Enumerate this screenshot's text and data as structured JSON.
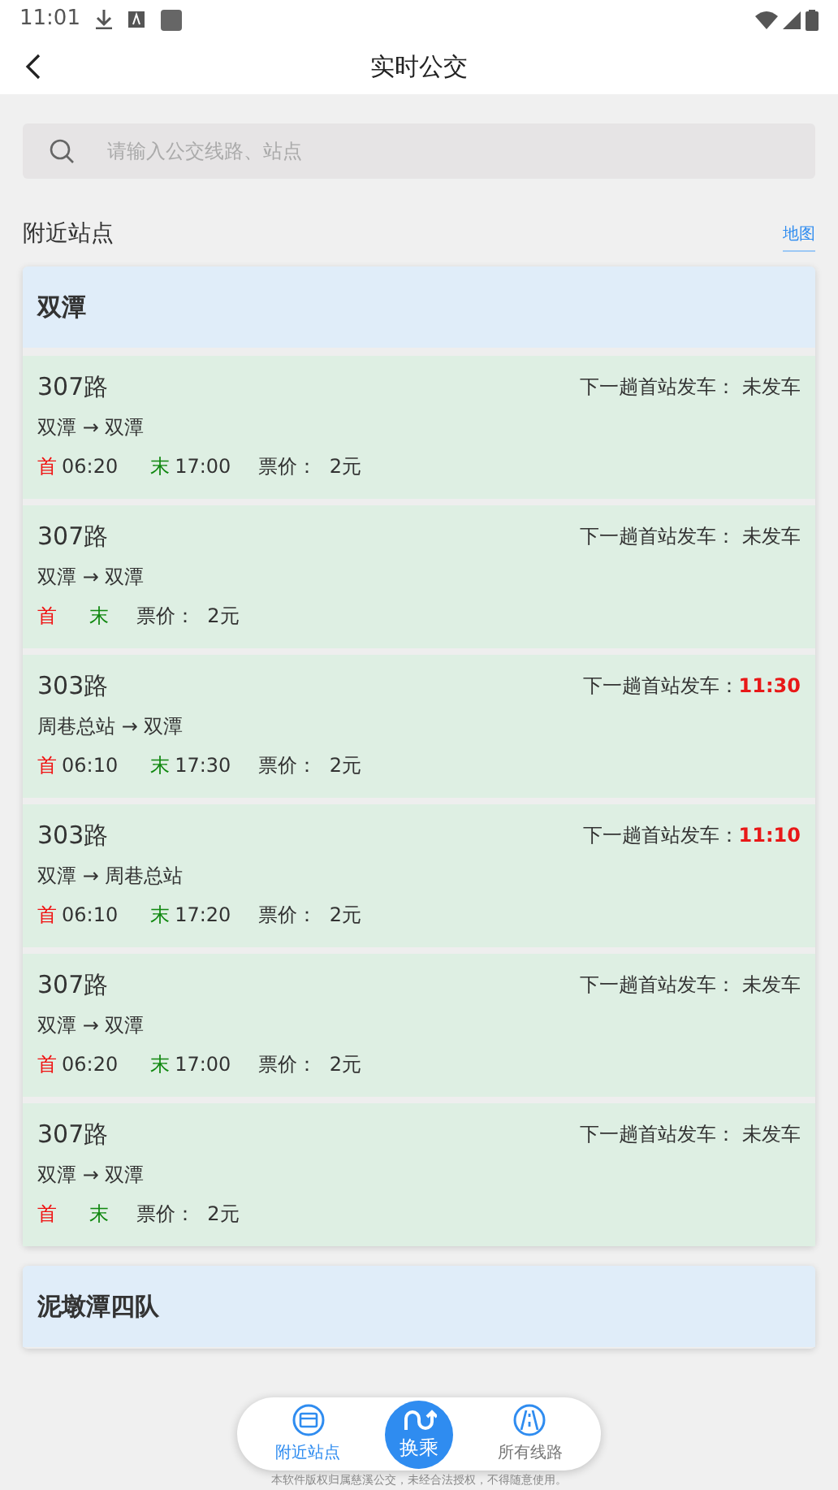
{
  "status_bar": {
    "time": "11:01"
  },
  "header": {
    "title": "实时公交"
  },
  "search": {
    "placeholder": "请输入公交线路、站点"
  },
  "section": {
    "title": "附近站点",
    "link": "地图"
  },
  "stations": [
    {
      "name": "双潭",
      "routes": [
        {
          "name": "307路",
          "direction": "双潭 → 双潭",
          "first_label": "首",
          "first": "06:20",
          "last_label": "末",
          "last": "17:00",
          "price": "票价：  2元",
          "next_label": "下一趟首站发车：",
          "next": "未发车",
          "next_highlight": false
        },
        {
          "name": "307路",
          "direction": "双潭 → 双潭",
          "first_label": "首",
          "last_label": "末",
          "price": "票价：  2元",
          "next_label": "下一趟首站发车：",
          "next": "未发车",
          "next_highlight": false
        },
        {
          "name": "303路",
          "direction": "周巷总站 → 双潭",
          "first_label": "首",
          "first": "06:10",
          "last_label": "末",
          "last": "17:30",
          "price": "票价：  2元",
          "next_label": "下一趟首站发车：",
          "next": "11:30",
          "next_highlight": true
        },
        {
          "name": "303路",
          "direction": "双潭 → 周巷总站",
          "first_label": "首",
          "first": "06:10",
          "last_label": "末",
          "last": "17:20",
          "price": "票价：  2元",
          "next_label": "下一趟首站发车：",
          "next": "11:10",
          "next_highlight": true
        },
        {
          "name": "307路",
          "direction": "双潭 → 双潭",
          "first_label": "首",
          "first": "06:20",
          "last_label": "末",
          "last": "17:00",
          "price": "票价：  2元",
          "next_label": "下一趟首站发车：",
          "next": "未发车",
          "next_highlight": false
        },
        {
          "name": "307路",
          "direction": "双潭 → 双潭",
          "first_label": "首",
          "last_label": "末",
          "price": "票价：  2元",
          "next_label": "下一趟首站发车：",
          "next": "未发车",
          "next_highlight": false
        }
      ]
    },
    {
      "name": "泥墩潭四队"
    }
  ],
  "bottom_nav": [
    {
      "label": "附近站点",
      "kind": "station",
      "selected": true
    },
    {
      "label": "换乘",
      "kind": "transfer",
      "selected": false
    },
    {
      "label": "所有线路",
      "kind": "lines",
      "selected": false
    }
  ],
  "footer": "本软件版权归属慈溪公交，未经合法授权，不得随意使用。"
}
